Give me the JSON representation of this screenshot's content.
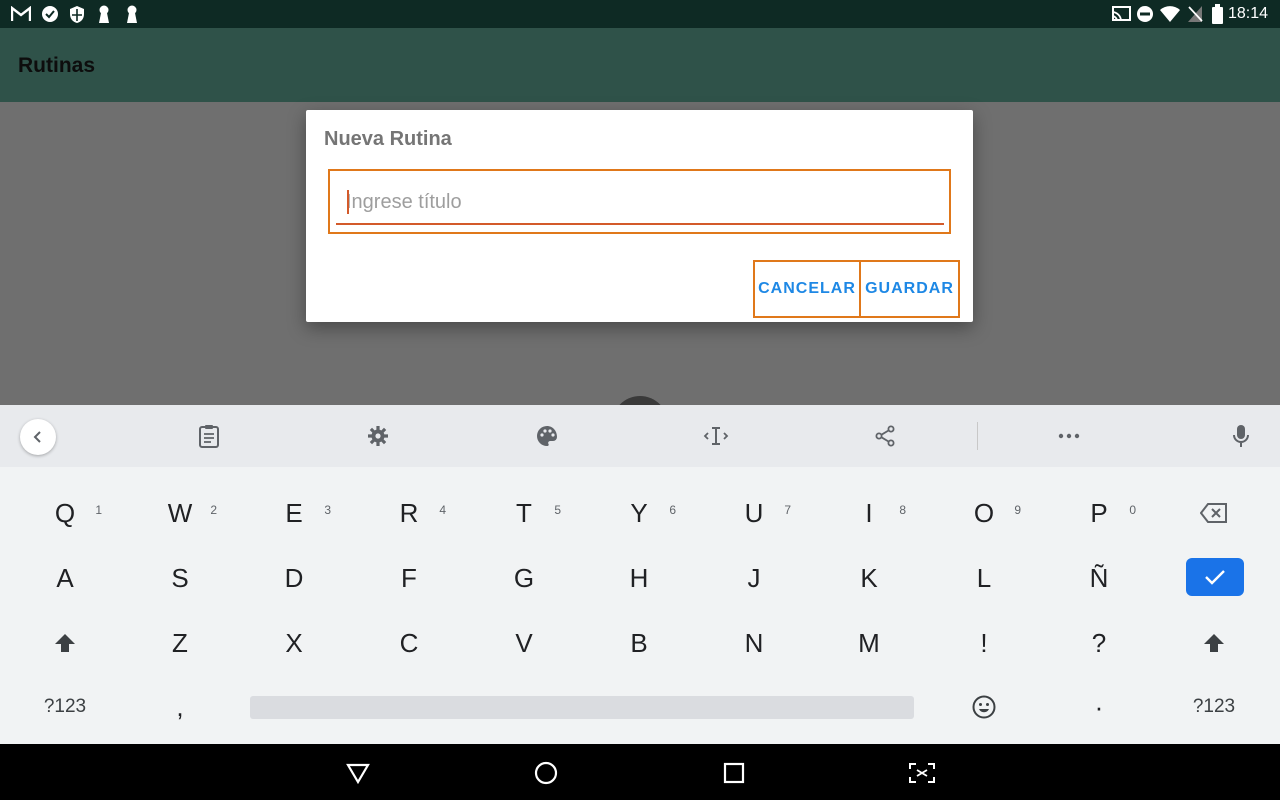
{
  "status_bar": {
    "left_icons": [
      "gmail-icon",
      "check-circle-icon",
      "shield-icon",
      "keyhole-icon",
      "keyhole-icon"
    ],
    "right_icons": [
      "cast-icon",
      "do-not-disturb-icon",
      "wifi-icon",
      "no-signal-icon",
      "battery-icon"
    ],
    "time": "18:14"
  },
  "app_bar": {
    "title": "Rutinas"
  },
  "dialog": {
    "title": "Nueva Rutina",
    "input_placeholder": "Ingrese título",
    "input_value": "",
    "cancel_label": "CANCELAR",
    "save_label": "GUARDAR",
    "highlight_color": "#e0781a",
    "button_color": "#1e88e5"
  },
  "keyboard_toolbar": {
    "icons": [
      "back-icon",
      "clipboard-icon",
      "settings-icon",
      "theme-icon",
      "text-cursor-icon",
      "share-icon",
      "more-icon",
      "microphone-icon"
    ]
  },
  "keyboard": {
    "row1": [
      {
        "label": "Q",
        "hint": "1"
      },
      {
        "label": "W",
        "hint": "2"
      },
      {
        "label": "E",
        "hint": "3"
      },
      {
        "label": "R",
        "hint": "4"
      },
      {
        "label": "T",
        "hint": "5"
      },
      {
        "label": "Y",
        "hint": "6"
      },
      {
        "label": "U",
        "hint": "7"
      },
      {
        "label": "I",
        "hint": "8"
      },
      {
        "label": "O",
        "hint": "9"
      },
      {
        "label": "P",
        "hint": "0"
      }
    ],
    "row2": [
      "A",
      "S",
      "D",
      "F",
      "G",
      "H",
      "J",
      "K",
      "L",
      "Ñ"
    ],
    "row3": [
      "Z",
      "X",
      "C",
      "V",
      "B",
      "N",
      "M",
      "!",
      "?"
    ],
    "row4": {
      "symbols_left": "?123",
      "comma": ",",
      "period": "·",
      "symbols_right": "?123"
    },
    "accent_color": "#1a73e8"
  },
  "nav_bar": {
    "icons": [
      "back-triangle-icon",
      "home-circle-icon",
      "recents-square-icon",
      "screenshot-icon"
    ]
  }
}
